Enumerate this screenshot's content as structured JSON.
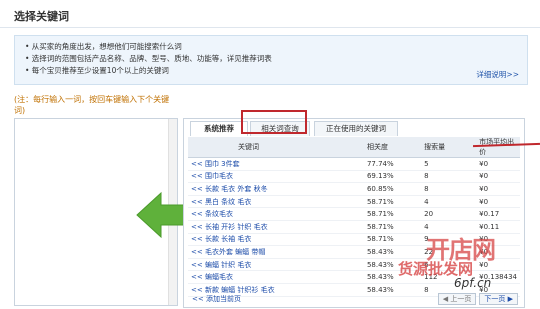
{
  "page_title": "选择关键词",
  "tips": [
    "• 从买家的角度出发，想想他们可能搜索什么词",
    "• 选择词的范围包括产品名称、品牌、型号、质地、功能等，详见推荐词表",
    "• 每个宝贝推荐至少设置10个以上的关键词"
  ],
  "more_link": "详细说明>>",
  "note": "(注：每行输入一词，按回车键输入下个关键词)",
  "tabs": [
    {
      "label": "系统推荐"
    },
    {
      "label": "相关词查询"
    },
    {
      "label": "正在使用的关键词"
    }
  ],
  "table": {
    "headers": [
      "关键词",
      "相关度",
      "搜索量",
      "市场平均出价"
    ],
    "rows": [
      [
        "<< 围巾 3件套",
        "77.74%",
        "5",
        "¥0"
      ],
      [
        "<< 围巾毛衣",
        "69.13%",
        "8",
        "¥0"
      ],
      [
        "<< 长款 毛衣 外套 秋冬",
        "60.85%",
        "8",
        "¥0"
      ],
      [
        "<< 黑白 条纹 毛衣",
        "58.71%",
        "4",
        "¥0"
      ],
      [
        "<< 条纹毛衣",
        "58.71%",
        "20",
        "¥0.17"
      ],
      [
        "<< 长袖 开衫 针织 毛衣",
        "58.71%",
        "4",
        "¥0.11"
      ],
      [
        "<< 长款 长袖 毛衣",
        "58.71%",
        "9",
        "¥0"
      ],
      [
        "<< 毛衣外套 蝙蝠 带帽",
        "58.43%",
        "22",
        "¥0"
      ],
      [
        "<< 蝙蝠 针织 毛衣",
        "58.43%",
        "6",
        "¥0"
      ],
      [
        "<< 蝙蝠毛衣",
        "58.43%",
        "112",
        "¥0.138434"
      ],
      [
        "<< 新款 蝙蝠 针织衫 毛衣",
        "58.43%",
        "8",
        "¥0"
      ]
    ]
  },
  "footer": {
    "add_label": "<< 添加当前页",
    "prev_label": "◀ 上一页",
    "next_label": "下一页 ▶"
  },
  "watermark": {
    "big": "开店网",
    "mid": "货源批发网",
    "url": "6pf.cn"
  },
  "colors": {
    "highlight": "#c0282d",
    "arrow": "#5fb13b",
    "link": "#1a4aa8"
  }
}
